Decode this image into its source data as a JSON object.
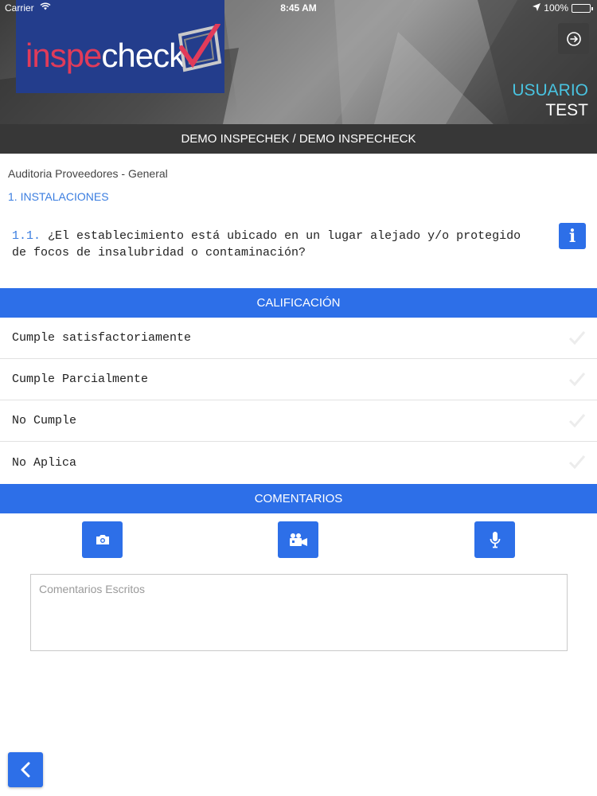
{
  "status_bar": {
    "carrier": "Carrier",
    "time": "8:45 AM",
    "battery": "100%",
    "battery_level": 1.0
  },
  "header": {
    "logo_part1": "inspe",
    "logo_part2": "check",
    "user_title": "USUARIO",
    "user_name": "TEST",
    "logout_icon": "logout-icon"
  },
  "company_bar": {
    "label": "DEMO INSPECHEK / DEMO INSPECHECK"
  },
  "audit": {
    "breadcrumb": "Auditoria Proveedores - General",
    "section": "1. INSTALACIONES",
    "question_number": "1.1.",
    "question_text": "¿El establecimiento está ubicado en un lugar alejado y/o protegido de focos de insalubridad o contaminación?"
  },
  "rating": {
    "header": "CALIFICACIÓN",
    "options": [
      {
        "label": "Cumple satisfactoriamente"
      },
      {
        "label": "Cumple Parcialmente"
      },
      {
        "label": "No Cumple"
      },
      {
        "label": "No Aplica"
      }
    ]
  },
  "comments": {
    "header": "COMENTARIOS",
    "placeholder": "Comentarios Escritos",
    "value": ""
  },
  "colors": {
    "accent": "#2d6fe8",
    "dark_bar": "#373737",
    "logo_bg": "#233d8c",
    "logo_red": "#e13b5a",
    "user_title": "#49c3e0"
  },
  "icons": {
    "camera": "camera-icon",
    "video": "video-camera-icon",
    "mic": "microphone-icon",
    "back": "chevron-left-icon",
    "info": "info-icon",
    "check": "check-icon"
  }
}
